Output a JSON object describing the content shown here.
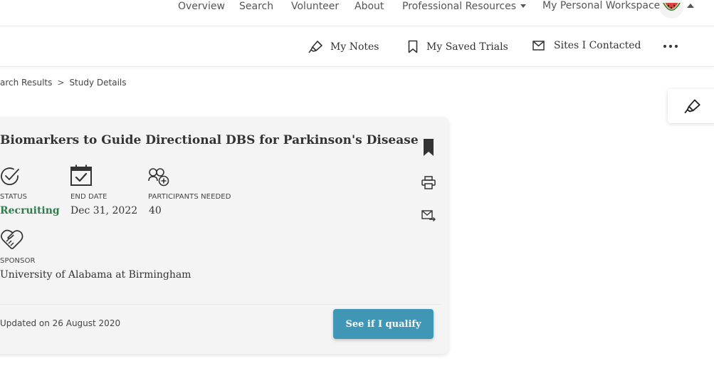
{
  "top_nav": {
    "overview": "Overview",
    "search": "Search",
    "volunteer": "Volunteer",
    "about": "About",
    "professional_resources": "Professional Resources",
    "workspace": "My Personal Workspace",
    "avatar_icon": "watermelon-avatar-icon"
  },
  "sub_nav": {
    "notes": "My Notes",
    "saved_trials": "My Saved Trials",
    "sites_contacted": "Sites I Contacted",
    "more_icon": "more-horizontal-icon"
  },
  "breadcrumb": {
    "search_results": "arch Results",
    "separator": ">",
    "study_details": "Study Details"
  },
  "study": {
    "title": "Biomarkers to Guide Directional DBS for Parkinson's Disease",
    "status_label": "STATUS",
    "status_value": "Recruiting",
    "end_date_label": "END DATE",
    "end_date_value": "Dec 31, 2022",
    "participants_label": "PARTICIPANTS NEEDED",
    "participants_value": "40",
    "sponsor_label": "SPONSOR",
    "sponsor_value": "University of Alabama at Birmingham",
    "updated": "Updated on 26 August 2020",
    "qualify_button": "See if I qualify"
  },
  "colors": {
    "status_green": "#2e7d4f",
    "button_blue": "#3f97b5",
    "card_bg": "#f3f4f3"
  }
}
